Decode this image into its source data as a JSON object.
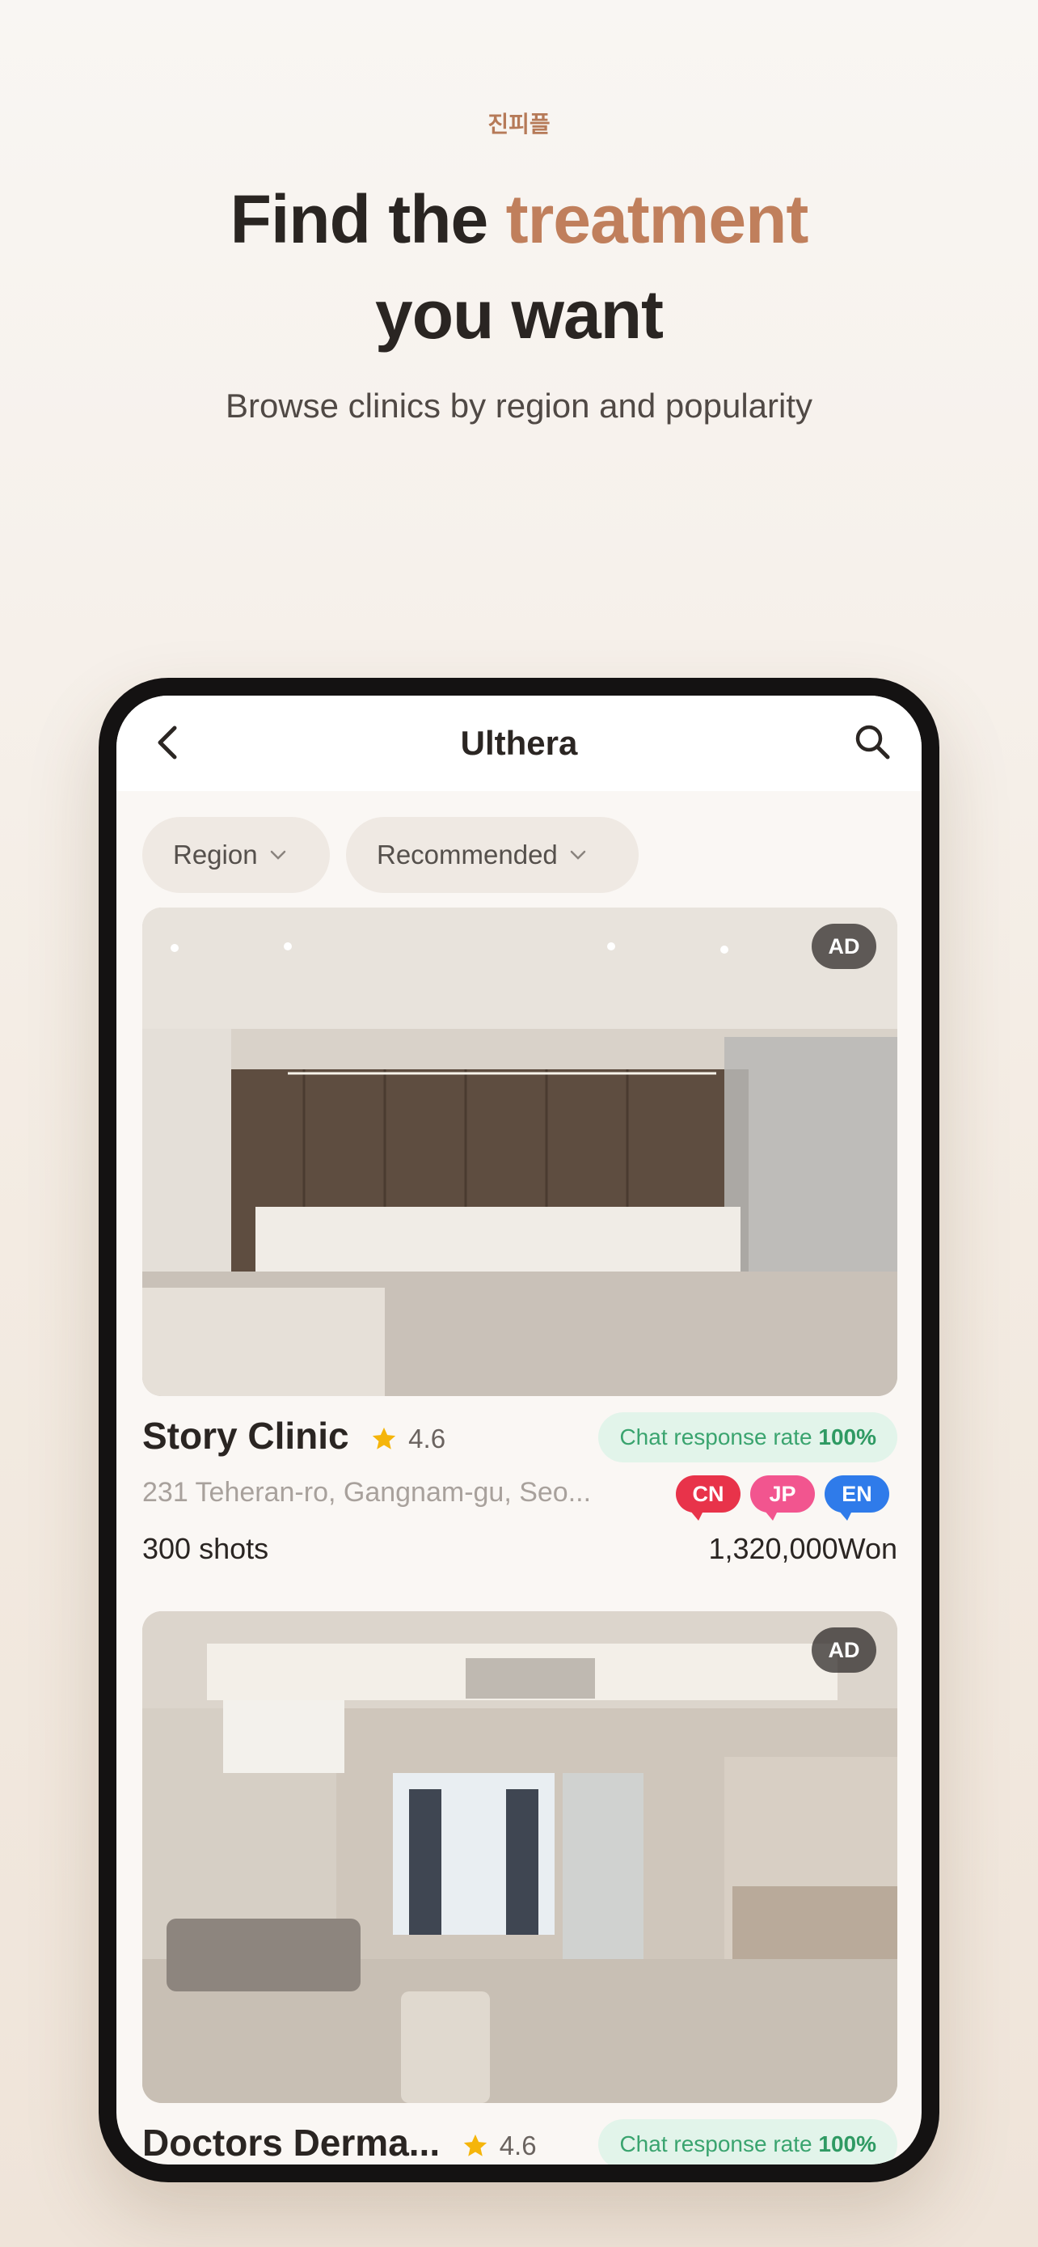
{
  "hero": {
    "brand": "진피플",
    "headline_part1": "Find the ",
    "headline_accent": "treatment",
    "headline_part2": "you want",
    "subtitle": "Browse clinics by region and popularity"
  },
  "app": {
    "title": "Ulthera",
    "back_icon": "chevron-left-icon",
    "search_icon": "search-icon"
  },
  "filters": [
    {
      "label": "Region"
    },
    {
      "label": "Recommended"
    }
  ],
  "clinics": [
    {
      "ad_label": "AD",
      "name": "Story Clinic",
      "rating": "4.6",
      "response_prefix": "Chat response rate ",
      "response_rate": "100%",
      "address": "231 Teheran-ro, Gangnam-gu, Seo...",
      "languages": [
        "CN",
        "JP",
        "EN"
      ],
      "shots": "300 shots",
      "price": "1,320,000Won"
    },
    {
      "ad_label": "AD",
      "name": "Doctors Derma...",
      "rating": "4.6",
      "response_prefix": "Chat response rate ",
      "response_rate": "100%"
    }
  ],
  "colors": {
    "accent": "#c07f5c",
    "cn": "#e8334a",
    "jp": "#f2558f",
    "en": "#2f7bea",
    "response_bg": "#e2f4ea",
    "response_text": "#3aa46f"
  }
}
